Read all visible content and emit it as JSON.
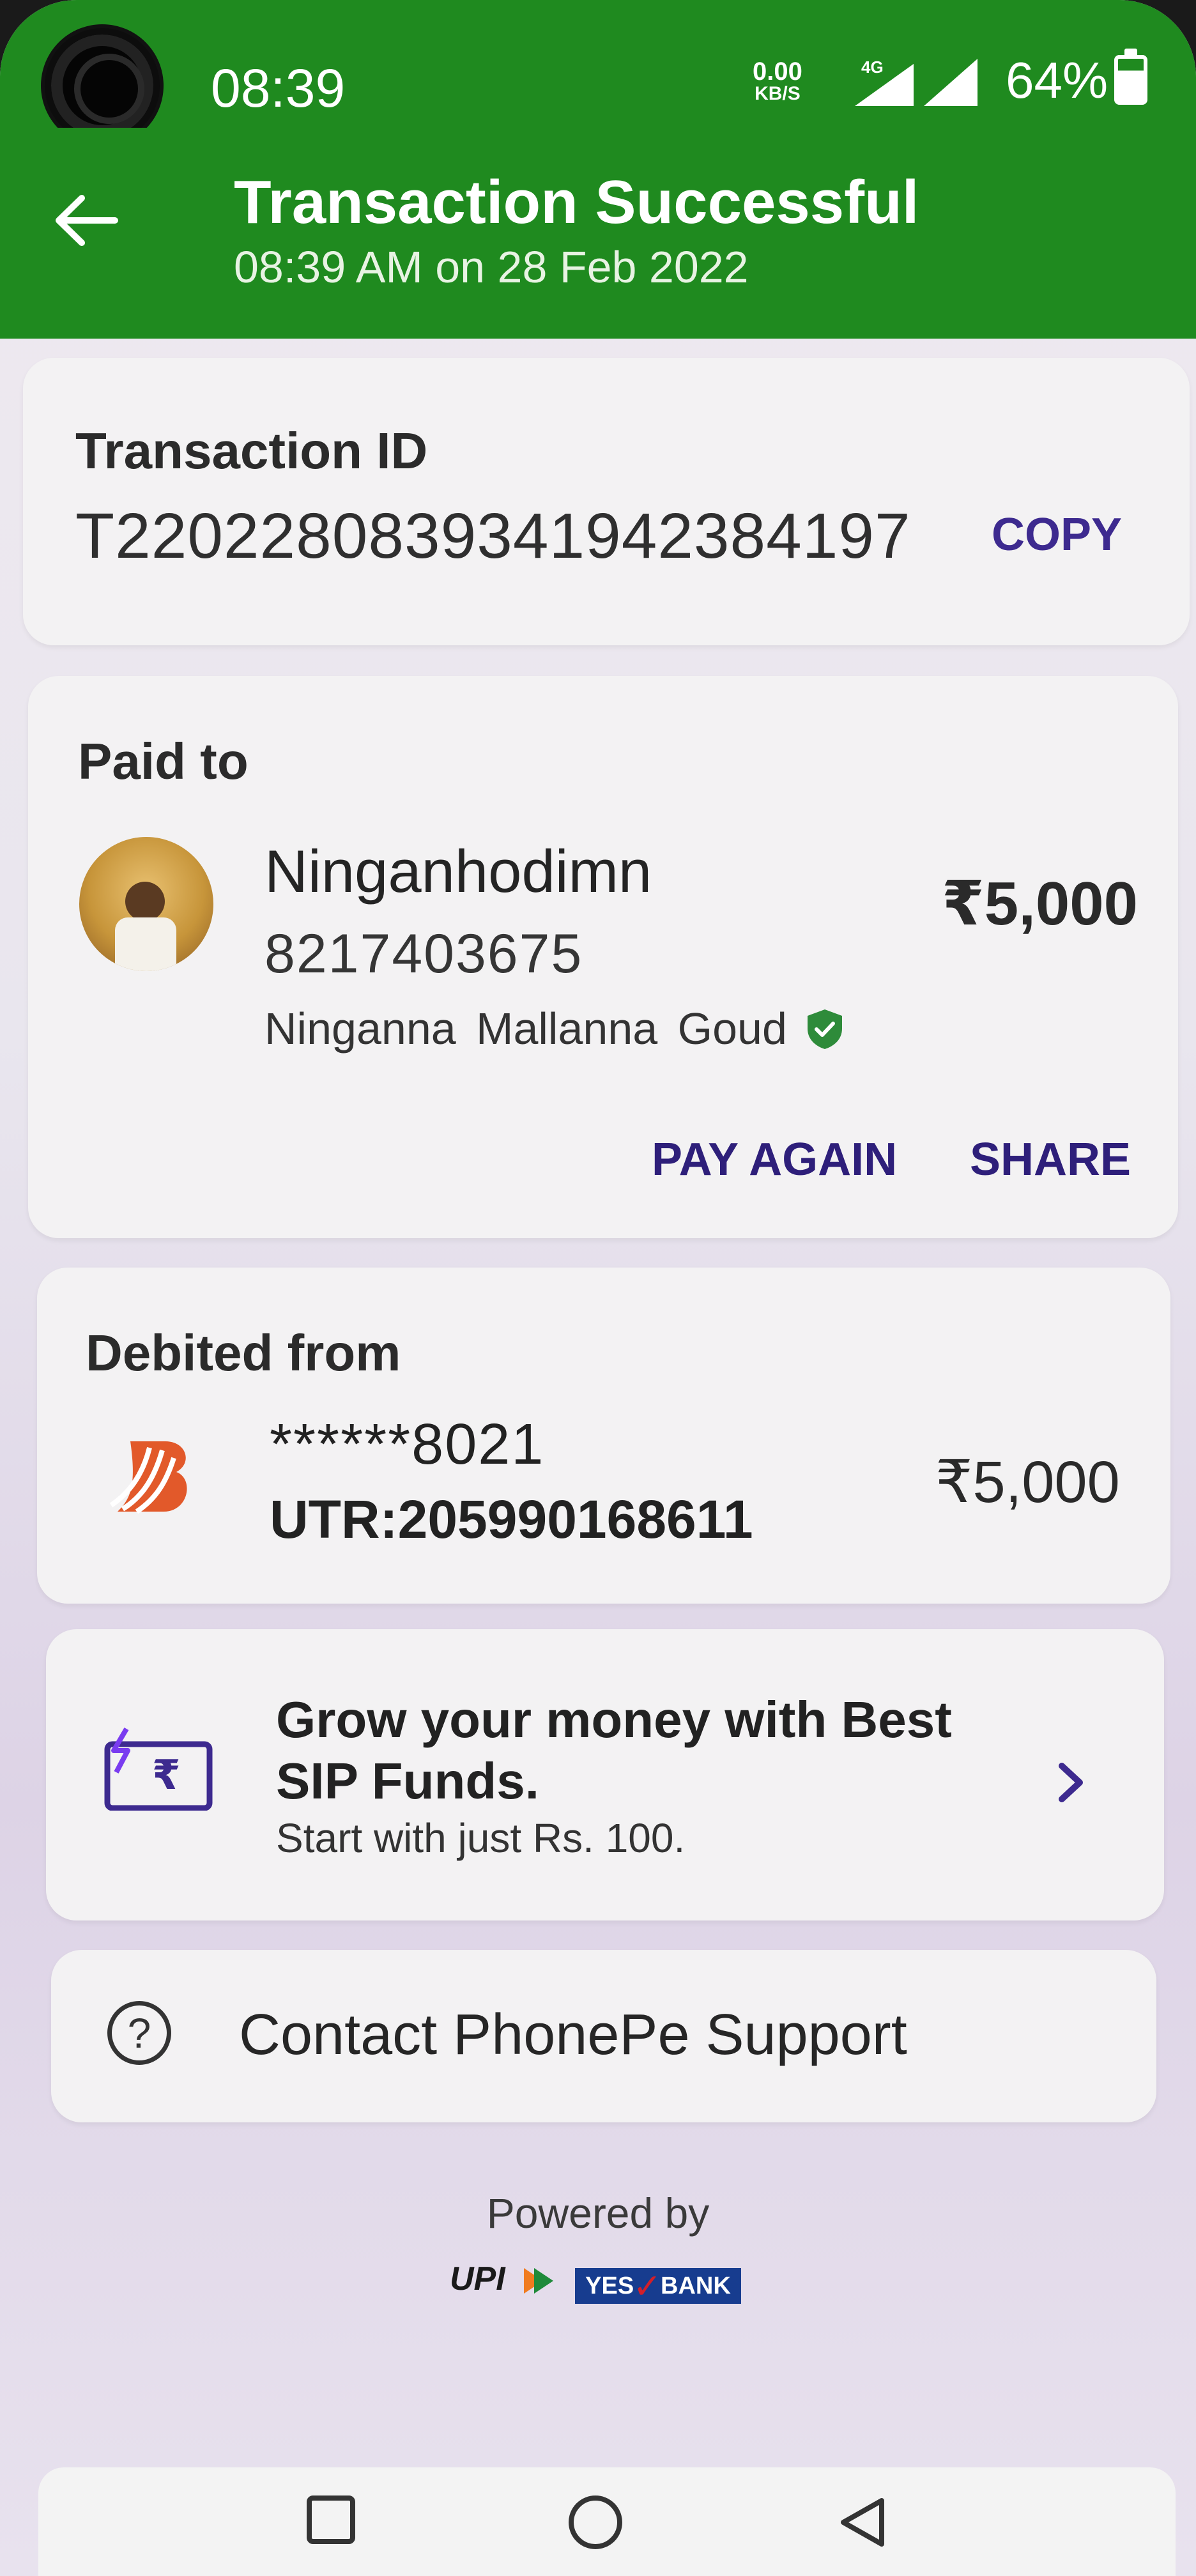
{
  "status_bar": {
    "time": "08:39",
    "net_speed_value": "0.00",
    "net_speed_unit": "KB/S",
    "network_type": "4G",
    "battery_percent": "64%"
  },
  "header": {
    "title": "Transaction Successful",
    "subtitle": "08:39 AM on 28 Feb 2022",
    "background_color": "#1f8a1f"
  },
  "transaction": {
    "label": "Transaction ID",
    "id": "T2202280839341942384197",
    "copy_label": "COPY"
  },
  "paid_to": {
    "label": "Paid to",
    "name": "Ninganhodimn",
    "phone": "8217403675",
    "legal_name": "Ninganna  Mallanna Goud",
    "amount": "₹5,000",
    "pay_again_label": "PAY AGAIN",
    "share_label": "SHARE"
  },
  "debited_from": {
    "label": "Debited from",
    "account_masked": "******8021",
    "utr": "UTR:205990168611",
    "amount": "₹5,000",
    "bank_icon": "bank-of-baroda-logo"
  },
  "promo": {
    "title": "Grow your money with Best SIP Funds.",
    "subtitle": "Start with just Rs. 100.",
    "icon": "sip-rupee-card-icon"
  },
  "support": {
    "label": "Contact PhonePe Support",
    "icon": "help-circle-icon"
  },
  "footer": {
    "powered_by": "Powered by",
    "upi_logo_text": "UPI",
    "partner_bank_yes": "YES",
    "partner_bank_bank": "BANK"
  },
  "colors": {
    "accent_purple": "#2e1f7a",
    "success_green": "#1f8a1f",
    "verified_green": "#2e8b3a"
  }
}
